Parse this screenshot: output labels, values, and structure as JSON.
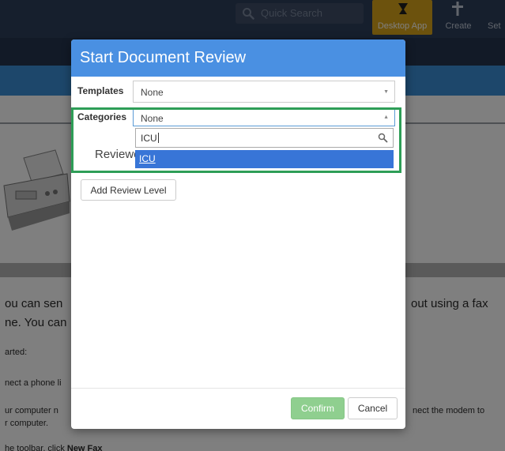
{
  "app": {
    "search": {
      "placeholder": "Quick Search",
      "icon": "search-icon"
    },
    "nav": {
      "desktop_app": {
        "label": "Desktop App",
        "icon": "desktop-download-icon",
        "color": "#d8a41a"
      },
      "create": {
        "label": "Create",
        "icon": "plus-icon"
      },
      "settings": {
        "label": "Set"
      }
    },
    "colors": {
      "topbar": "#2c3e5a",
      "subbar": "#24354f",
      "bluebar": "#3b8fd6"
    },
    "content_lines": [
      "ou can sen",
      "ne. You can",
      "arted:",
      "nect a phone li",
      "ur computer n",
      "r computer.",
      "he toolbar, click ",
      "New Fax",
      "out using a fax",
      "nect the modem to"
    ]
  },
  "modal": {
    "title": "Start Document Review",
    "header_color": "#4a90e2",
    "templates": {
      "label": "Templates",
      "value": "None"
    },
    "categories": {
      "label": "Categories",
      "value": "None",
      "search_value": "ICU",
      "results": [
        "ICU"
      ],
      "highlight_color": "#2e9e57"
    },
    "reviewer_label": "Reviewer",
    "add_review_level_label": "Add Review Level",
    "confirm_label": "Confirm",
    "cancel_label": "Cancel"
  }
}
